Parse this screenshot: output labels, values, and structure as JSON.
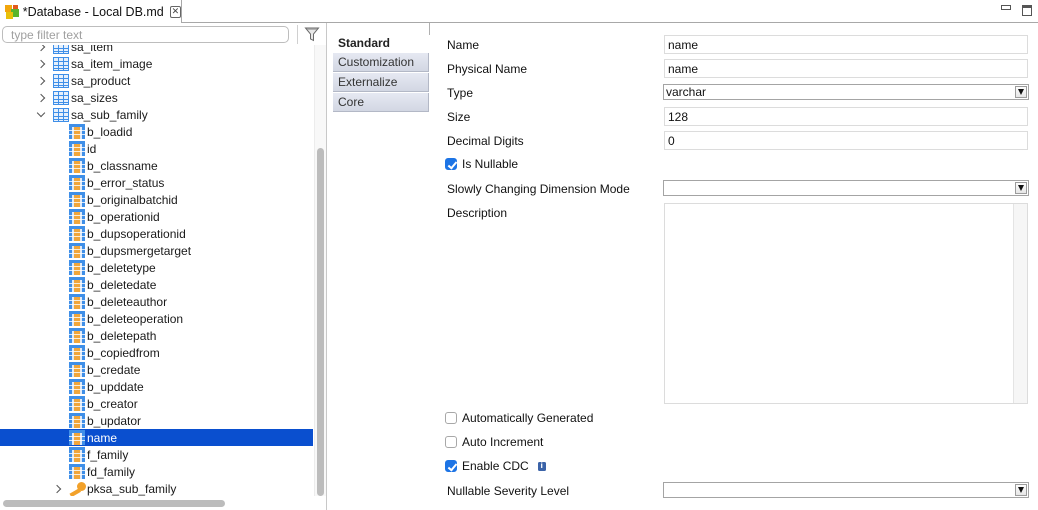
{
  "editor": {
    "tab_title": "*Database - Local DB.md",
    "close_glyph": "✕"
  },
  "window_controls": {
    "minimize_icon": "minimize-icon",
    "maximize_icon": "maximize-icon"
  },
  "filter": {
    "placeholder": "type filter text",
    "value": "",
    "icon": "filter-icon"
  },
  "tree": {
    "items": [
      {
        "label": "sa_item",
        "type": "table",
        "level": 1,
        "expanded": false
      },
      {
        "label": "sa_item_image",
        "type": "table",
        "level": 1,
        "expanded": false
      },
      {
        "label": "sa_product",
        "type": "table",
        "level": 1,
        "expanded": false
      },
      {
        "label": "sa_sizes",
        "type": "table",
        "level": 1,
        "expanded": false
      },
      {
        "label": "sa_sub_family",
        "type": "table",
        "level": 1,
        "expanded": true
      },
      {
        "label": "b_loadid",
        "type": "column",
        "level": 2
      },
      {
        "label": "id",
        "type": "column",
        "level": 2
      },
      {
        "label": "b_classname",
        "type": "column",
        "level": 2
      },
      {
        "label": "b_error_status",
        "type": "column",
        "level": 2
      },
      {
        "label": "b_originalbatchid",
        "type": "column",
        "level": 2
      },
      {
        "label": "b_operationid",
        "type": "column",
        "level": 2
      },
      {
        "label": "b_dupsoperationid",
        "type": "column",
        "level": 2
      },
      {
        "label": "b_dupsmergetarget",
        "type": "column",
        "level": 2
      },
      {
        "label": "b_deletetype",
        "type": "column",
        "level": 2
      },
      {
        "label": "b_deletedate",
        "type": "column",
        "level": 2
      },
      {
        "label": "b_deleteauthor",
        "type": "column",
        "level": 2
      },
      {
        "label": "b_deleteoperation",
        "type": "column",
        "level": 2
      },
      {
        "label": "b_deletepath",
        "type": "column",
        "level": 2
      },
      {
        "label": "b_copiedfrom",
        "type": "column",
        "level": 2
      },
      {
        "label": "b_credate",
        "type": "column",
        "level": 2
      },
      {
        "label": "b_upddate",
        "type": "column",
        "level": 2
      },
      {
        "label": "b_creator",
        "type": "column",
        "level": 2
      },
      {
        "label": "b_updator",
        "type": "column",
        "level": 2
      },
      {
        "label": "name",
        "type": "column",
        "level": 2,
        "selected": true
      },
      {
        "label": "f_family",
        "type": "column",
        "level": 2
      },
      {
        "label": "fd_family",
        "type": "column",
        "level": 2
      },
      {
        "label": "pksa_sub_family",
        "type": "key",
        "level": 2,
        "expanded": false
      }
    ],
    "selection_color": "#0a4fcf"
  },
  "property_tabs": [
    {
      "label": "Standard",
      "active": true
    },
    {
      "label": "Customization",
      "active": false
    },
    {
      "label": "Externalize",
      "active": false
    },
    {
      "label": "Core",
      "active": false
    }
  ],
  "form": {
    "name": {
      "label": "Name",
      "value": "name"
    },
    "physical_name": {
      "label": "Physical Name",
      "value": "name"
    },
    "type": {
      "label": "Type",
      "value": "varchar"
    },
    "size": {
      "label": "Size",
      "value": "128"
    },
    "decimal_digits": {
      "label": "Decimal Digits",
      "value": "0"
    },
    "is_nullable": {
      "label": "Is Nullable",
      "checked": true
    },
    "scd_mode": {
      "label": "Slowly Changing Dimension Mode",
      "value": ""
    },
    "description": {
      "label": "Description",
      "value": ""
    },
    "auto_generated": {
      "label": "Automatically Generated",
      "checked": false
    },
    "auto_increment": {
      "label": "Auto Increment",
      "checked": false
    },
    "enable_cdc": {
      "label": "Enable CDC",
      "checked": true,
      "info_glyph": "i"
    },
    "nullable_severity": {
      "label": "Nullable Severity Level",
      "value": ""
    }
  },
  "colors": {
    "checkbox_accent": "#1d74e5",
    "table_icon_blue": "#3f8fe8",
    "column_icon_orange": "#f1a63b",
    "key_icon_orange": "#f2a12a"
  }
}
